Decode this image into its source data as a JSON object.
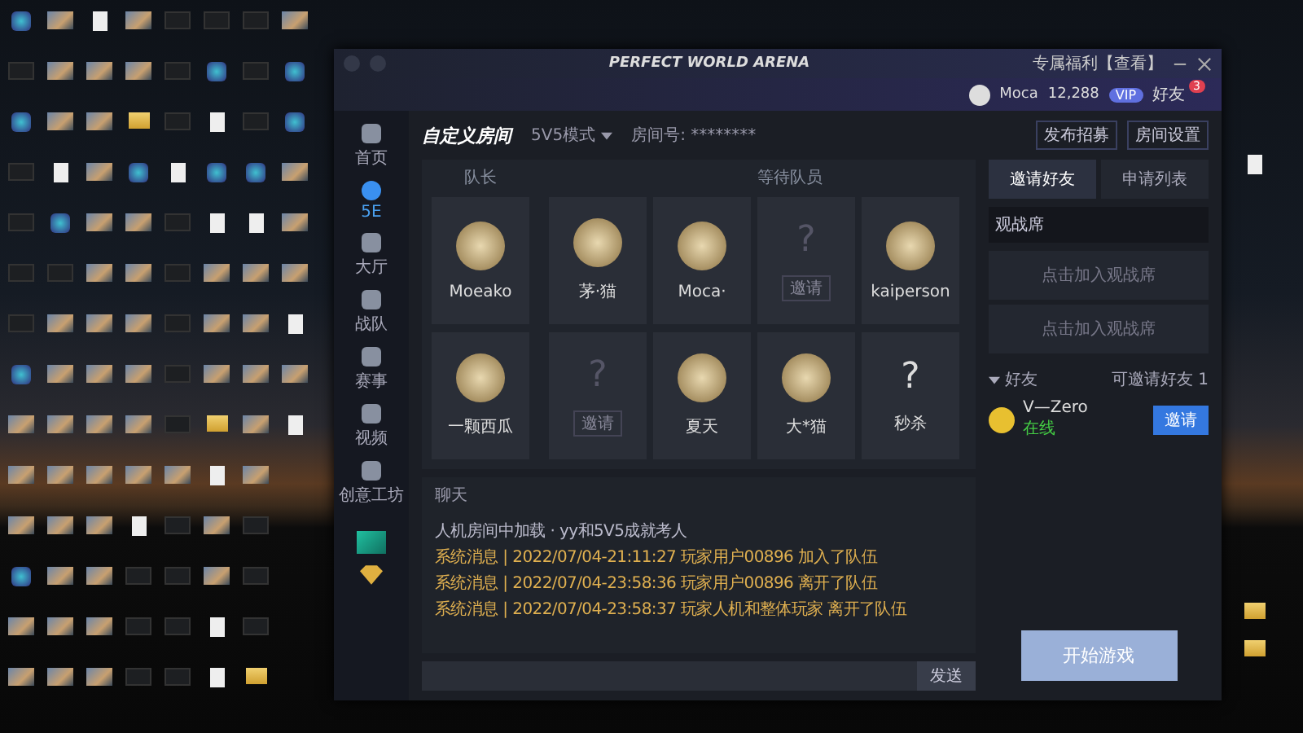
{
  "desktop_rows": [
    [
      {
        "kind": "app"
      },
      {
        "kind": "thumb"
      },
      {
        "kind": "doc"
      },
      {
        "kind": "thumb"
      },
      {
        "kind": "dark"
      },
      {
        "kind": "dark"
      },
      {
        "kind": "dark"
      },
      {
        "kind": "thumb"
      }
    ],
    [
      {
        "kind": "dark"
      },
      {
        "kind": "thumb"
      },
      {
        "kind": "thumb"
      },
      {
        "kind": "thumb"
      },
      {
        "kind": "dark"
      },
      {
        "kind": "app"
      },
      {
        "kind": "dark"
      },
      {
        "kind": "app"
      }
    ],
    [
      {
        "kind": "app"
      },
      {
        "kind": "thumb"
      },
      {
        "kind": "thumb"
      },
      {
        "kind": "folder"
      },
      {
        "kind": "dark"
      },
      {
        "kind": "doc"
      },
      {
        "kind": "dark"
      },
      {
        "kind": "app"
      }
    ],
    [
      {
        "kind": "dark"
      },
      {
        "kind": "doc"
      },
      {
        "kind": "thumb"
      },
      {
        "kind": "app"
      },
      {
        "kind": "doc"
      },
      {
        "kind": "app"
      },
      {
        "kind": "app"
      },
      {
        "kind": "thumb"
      }
    ],
    [
      {
        "kind": "dark"
      },
      {
        "kind": "app"
      },
      {
        "kind": "thumb"
      },
      {
        "kind": "thumb"
      },
      {
        "kind": "dark"
      },
      {
        "kind": "doc"
      },
      {
        "kind": "doc"
      },
      {
        "kind": "thumb"
      }
    ],
    [
      {
        "kind": "dark"
      },
      {
        "kind": "dark"
      },
      {
        "kind": "thumb"
      },
      {
        "kind": "thumb"
      },
      {
        "kind": "dark"
      },
      {
        "kind": "thumb"
      },
      {
        "kind": "thumb"
      },
      {
        "kind": "thumb"
      }
    ],
    [
      {
        "kind": "dark"
      },
      {
        "kind": "thumb"
      },
      {
        "kind": "thumb"
      },
      {
        "kind": "thumb"
      },
      {
        "kind": "dark"
      },
      {
        "kind": "thumb"
      },
      {
        "kind": "thumb"
      },
      {
        "kind": "doc"
      }
    ],
    [
      {
        "kind": "app"
      },
      {
        "kind": "thumb"
      },
      {
        "kind": "thumb"
      },
      {
        "kind": "thumb"
      },
      {
        "kind": "dark"
      },
      {
        "kind": "thumb"
      },
      {
        "kind": "thumb"
      },
      {
        "kind": "thumb"
      }
    ],
    [
      {
        "kind": "thumb"
      },
      {
        "kind": "thumb"
      },
      {
        "kind": "thumb"
      },
      {
        "kind": "thumb"
      },
      {
        "kind": "dark"
      },
      {
        "kind": "folder"
      },
      {
        "kind": "thumb"
      },
      {
        "kind": "doc"
      }
    ],
    [
      {
        "kind": "thumb"
      },
      {
        "kind": "thumb"
      },
      {
        "kind": "thumb"
      },
      {
        "kind": "thumb"
      },
      {
        "kind": "thumb"
      },
      {
        "kind": "doc"
      },
      {
        "kind": "thumb"
      }
    ],
    [
      {
        "kind": "thumb"
      },
      {
        "kind": "thumb"
      },
      {
        "kind": "thumb"
      },
      {
        "kind": "doc"
      },
      {
        "kind": "dark"
      },
      {
        "kind": "thumb"
      },
      {
        "kind": "dark"
      }
    ],
    [
      {
        "kind": "app"
      },
      {
        "kind": "thumb"
      },
      {
        "kind": "thumb"
      },
      {
        "kind": "dark"
      },
      {
        "kind": "dark"
      },
      {
        "kind": "thumb"
      },
      {
        "kind": "dark"
      }
    ],
    [
      {
        "kind": "thumb"
      },
      {
        "kind": "thumb"
      },
      {
        "kind": "thumb"
      },
      {
        "kind": "dark"
      },
      {
        "kind": "dark"
      },
      {
        "kind": "doc"
      },
      {
        "kind": "dark"
      }
    ],
    [
      {
        "kind": "thumb"
      },
      {
        "kind": "thumb"
      },
      {
        "kind": "thumb"
      },
      {
        "kind": "dark"
      },
      {
        "kind": "dark"
      },
      {
        "kind": "doc"
      },
      {
        "kind": "folder"
      }
    ]
  ],
  "desktop_right": [
    {
      "kind": "doc"
    },
    {
      "kind": "folder"
    },
    {
      "kind": "folder"
    }
  ],
  "window": {
    "title": "PERFECT WORLD ARENA",
    "promo": "专属福利【查看】",
    "user": "Moca",
    "points": "12,288",
    "vip": "VIP",
    "friends": "好友",
    "friends_badge": "3"
  },
  "sidebar": [
    {
      "label": "首页",
      "selected": false
    },
    {
      "label": "5E",
      "selected": true
    },
    {
      "label": "大厅",
      "selected": false
    },
    {
      "label": "战队",
      "selected": false
    },
    {
      "label": "赛事",
      "selected": false
    },
    {
      "label": "视频",
      "selected": false
    },
    {
      "label": "创意工坊",
      "selected": false
    }
  ],
  "toolbar": {
    "logo": "自定义房间",
    "mode": "5V5模式",
    "room": "房间号: ********"
  },
  "room_actions": [
    "发布招募",
    "房间设置"
  ],
  "team_labels": [
    "队长",
    "等待队员"
  ],
  "players": [
    [
      {
        "name": "Moeako",
        "kind": "player"
      },
      {
        "name": "茅·猫",
        "kind": "player"
      },
      {
        "name": "Moca·",
        "kind": "player"
      },
      {
        "name": "邀请",
        "kind": "empty",
        "mark": "?"
      },
      {
        "name": "kaiperson",
        "kind": "player"
      }
    ],
    [
      {
        "name": "一颗西瓜",
        "kind": "player"
      },
      {
        "name": "邀请",
        "kind": "empty",
        "mark": "?"
      },
      {
        "name": "夏天",
        "kind": "player"
      },
      {
        "name": "大*猫",
        "kind": "player"
      },
      {
        "name": "秒杀",
        "kind": "unknown",
        "mark": "?"
      }
    ]
  ],
  "chat": {
    "tab": "聊天",
    "lines": [
      {
        "text": "人机房间中加载 · yy和5V5成就考人",
        "kind": "info"
      },
      {
        "text": "系统消息 | 2022/07/04-21:11:27 玩家用户00896 加入了队伍",
        "kind": "system"
      },
      {
        "text": "系统消息 | 2022/07/04-23:58:36 玩家用户00896 离开了队伍",
        "kind": "system"
      },
      {
        "text": "系统消息 | 2022/07/04-23:58:37 玩家人机和整体玩家 离开了队伍",
        "kind": "system"
      }
    ],
    "send": "发送"
  },
  "right_tabs": [
    {
      "label": "邀请好友",
      "selected": true
    },
    {
      "label": "申请列表",
      "selected": false
    }
  ],
  "spectate": {
    "title": "观战席",
    "slots": [
      "点击加入观战席",
      "点击加入观战席"
    ]
  },
  "friends": {
    "group": "好友",
    "count": "可邀请好友 1",
    "items": [
      {
        "name": "V—Zero",
        "status": "在线",
        "action": "邀请"
      }
    ]
  },
  "start": "开始游戏"
}
